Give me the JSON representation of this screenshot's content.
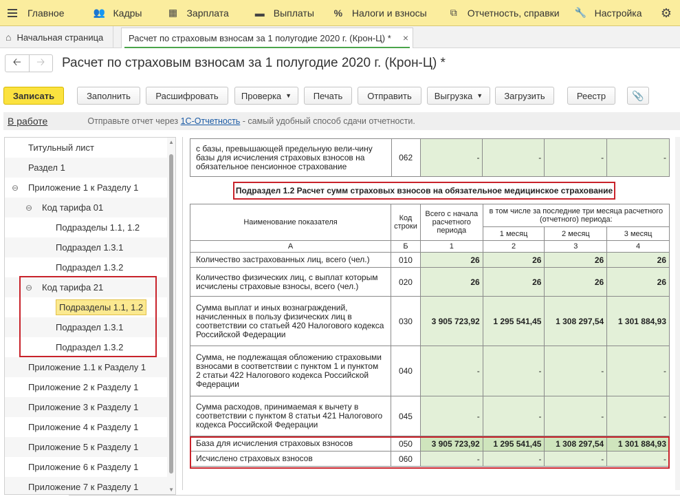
{
  "menu": {
    "items": [
      {
        "label": "Главное",
        "icon": "hamburger-icon"
      },
      {
        "label": "Кадры",
        "icon": "people-icon"
      },
      {
        "label": "Зарплата",
        "icon": "calculator-icon"
      },
      {
        "label": "Выплаты",
        "icon": "wallet-icon"
      },
      {
        "label": "Налоги и взносы",
        "icon": "percent-icon"
      },
      {
        "label": "Отчетность, справки",
        "icon": "documents-icon"
      },
      {
        "label": "Настройка",
        "icon": "wrench-icon"
      }
    ],
    "settings_icon": "gear-icon"
  },
  "tabs": {
    "home": "Начальная страница",
    "doc": "Расчет по страховым взносам за 1 полугодие 2020 г. (Крон-Ц) *",
    "close": "×"
  },
  "title": "Расчет по страховым взносам за 1 полугодие 2020 г. (Крон-Ц) *",
  "toolbar": {
    "save": "Записать",
    "fill": "Заполнить",
    "decode": "Расшифровать",
    "check": "Проверка",
    "print": "Печать",
    "send": "Отправить",
    "export": "Выгрузка",
    "load": "Загрузить",
    "registry": "Реестр",
    "attach_icon": "paperclip-icon"
  },
  "status": {
    "state": "В работе",
    "hint_before": "Отправьте отчет через ",
    "hint_link": "1С-Отчетность",
    "hint_after": " - самый удобный способ сдачи отчетности."
  },
  "tree": [
    {
      "label": "Титульный лист"
    },
    {
      "label": "Раздел 1"
    },
    {
      "label": "Приложение 1 к Разделу 1",
      "expander": "⊖"
    },
    {
      "label": "Код тарифа 01",
      "expander": "⊖"
    },
    {
      "label": "Подразделы 1.1, 1.2"
    },
    {
      "label": "Подраздел 1.3.1"
    },
    {
      "label": "Подраздел 1.3.2"
    },
    {
      "label": "Код тарифа 21",
      "expander": "⊖"
    },
    {
      "label": "Подразделы 1.1, 1.2"
    },
    {
      "label": "Подраздел 1.3.1"
    },
    {
      "label": "Подраздел 1.3.2"
    },
    {
      "label": "Приложение 1.1 к Разделу 1"
    },
    {
      "label": "Приложение 2 к Разделу 1"
    },
    {
      "label": "Приложение 3 к Разделу 1"
    },
    {
      "label": "Приложение 4 к Разделу 1"
    },
    {
      "label": "Приложение 5 к Разделу 1"
    },
    {
      "label": "Приложение 6 к Разделу 1"
    },
    {
      "label": "Приложение 7 к Разделу 1"
    }
  ],
  "report": {
    "top_row": {
      "name": "с базы, превышающей предельную вели-чину базы для исчисления страховых взносов на обязательное пенсионное страхование",
      "code": "062",
      "values": [
        "-",
        "-",
        "-",
        "-"
      ]
    },
    "subsection_title": "Подраздел 1.2 Расчет сумм страховых взносов на обязательное медицинское страхование",
    "header": {
      "name": "Наименование показателя",
      "code": "Код строки",
      "total": "Всего с начала расчетного периода",
      "last3": "в том числе за последние три месяца расчетного (отчетного) периода:",
      "m1": "1 месяц",
      "m2": "2 месяц",
      "m3": "3 месяц",
      "colA": "А",
      "colB": "Б",
      "col1": "1",
      "col2": "2",
      "col3": "3",
      "col4": "4"
    },
    "rows": [
      {
        "name": "Количество застрахованных лиц, всего (чел.)",
        "code": "010",
        "values": [
          "26",
          "26",
          "26",
          "26"
        ]
      },
      {
        "name": "Количество физических лиц, с выплат которым исчислены страховые взносы, всего (чел.)",
        "code": "020",
        "values": [
          "26",
          "26",
          "26",
          "26"
        ]
      },
      {
        "name": "Сумма выплат и иных вознаграждений, начисленных в пользу физических лиц в соответствии со статьей 420 Налогового кодекса Российской Федерации",
        "code": "030",
        "values": [
          "3 905 723,92",
          "1 295 541,45",
          "1 308 297,54",
          "1 301 884,93"
        ]
      },
      {
        "name": "Сумма, не подлежащая обложению страховыми взносами в соответствии с пунктом 1 и пунктом 2 статьи 422 Налогового кодекса Российской Федерации",
        "code": "040",
        "values": [
          "-",
          "-",
          "-",
          "-"
        ]
      },
      {
        "name": "Сумма расходов, принимаемая к вычету в соответствии с пунктом 8 статьи 421 Налогового кодекса Российской Федерации",
        "code": "045",
        "values": [
          "-",
          "-",
          "-",
          "-"
        ]
      },
      {
        "name": "База для исчисления страховых взносов",
        "code": "050",
        "values": [
          "3 905 723,92",
          "1 295 541,45",
          "1 308 297,54",
          "1 301 884,93"
        ]
      },
      {
        "name": "Исчислено страховых взносов",
        "code": "060",
        "values": [
          "-",
          "-",
          "-",
          "-"
        ]
      }
    ]
  }
}
